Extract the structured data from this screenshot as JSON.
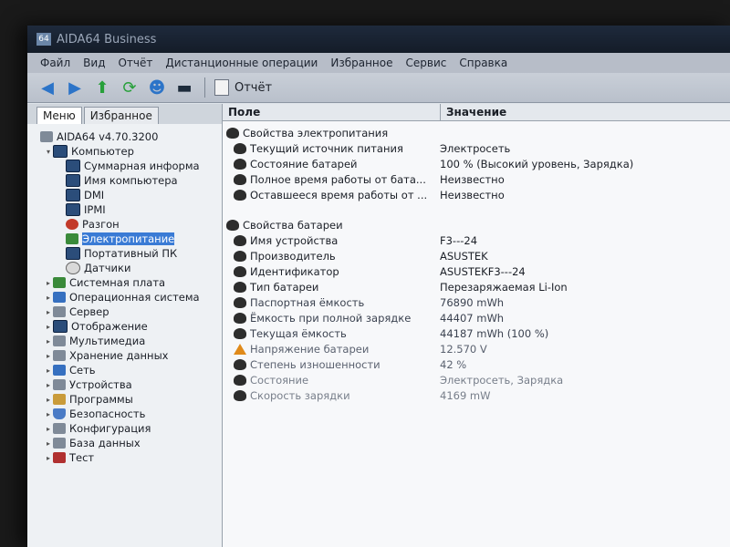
{
  "window": {
    "title": "AIDA64 Business"
  },
  "menu": [
    "Файл",
    "Вид",
    "Отчёт",
    "Дистанционные операции",
    "Избранное",
    "Сервис",
    "Справка"
  ],
  "toolbar": {
    "report_label": "Отчёт"
  },
  "left_tabs": [
    "Меню",
    "Избранное"
  ],
  "tree": [
    {
      "label": "AIDA64 v4.70.3200",
      "level": 0,
      "expander": "",
      "icon": "app"
    },
    {
      "label": "Компьютер",
      "level": 1,
      "expander": "▾",
      "icon": "monitor"
    },
    {
      "label": "Суммарная информа",
      "level": 2,
      "expander": "",
      "icon": "monitor"
    },
    {
      "label": "Имя компьютера",
      "level": 2,
      "expander": "",
      "icon": "monitor"
    },
    {
      "label": "DMI",
      "level": 2,
      "expander": "",
      "icon": "monitor"
    },
    {
      "label": "IPMI",
      "level": 2,
      "expander": "",
      "icon": "monitor"
    },
    {
      "label": "Разгон",
      "level": 2,
      "expander": "",
      "icon": "red"
    },
    {
      "label": "Электропитание",
      "level": 2,
      "expander": "",
      "icon": "chip",
      "selected": true
    },
    {
      "label": "Портативный ПК",
      "level": 2,
      "expander": "",
      "icon": "monitor"
    },
    {
      "label": "Датчики",
      "level": 2,
      "expander": "",
      "icon": "gauge"
    },
    {
      "label": "Системная плата",
      "level": 1,
      "expander": "▸",
      "icon": "chip"
    },
    {
      "label": "Операционная система",
      "level": 1,
      "expander": "▸",
      "icon": "blue"
    },
    {
      "label": "Сервер",
      "level": 1,
      "expander": "▸",
      "icon": "grey"
    },
    {
      "label": "Отображение",
      "level": 1,
      "expander": "▸",
      "icon": "monitor"
    },
    {
      "label": "Мультимедиа",
      "level": 1,
      "expander": "▸",
      "icon": "grey"
    },
    {
      "label": "Хранение данных",
      "level": 1,
      "expander": "▸",
      "icon": "grey"
    },
    {
      "label": "Сеть",
      "level": 1,
      "expander": "▸",
      "icon": "blue"
    },
    {
      "label": "Устройства",
      "level": 1,
      "expander": "▸",
      "icon": "grey"
    },
    {
      "label": "Программы",
      "level": 1,
      "expander": "▸",
      "icon": "folder"
    },
    {
      "label": "Безопасность",
      "level": 1,
      "expander": "▸",
      "icon": "shield"
    },
    {
      "label": "Конфигурация",
      "level": 1,
      "expander": "▸",
      "icon": "grey"
    },
    {
      "label": "База данных",
      "level": 1,
      "expander": "▸",
      "icon": "grey"
    },
    {
      "label": "Тест",
      "level": 1,
      "expander": "▸",
      "icon": "test"
    }
  ],
  "columns": {
    "field": "Поле",
    "value": "Значение"
  },
  "groups": [
    {
      "title": "Свойства электропитания",
      "rows": [
        {
          "field": "Текущий источник питания",
          "value": "Электросеть"
        },
        {
          "field": "Состояние батарей",
          "value": "100 % (Высокий уровень, Зарядка)"
        },
        {
          "field": "Полное время работы от бата...",
          "value": "Неизвестно"
        },
        {
          "field": "Оставшееся время работы от ...",
          "value": "Неизвестно"
        }
      ]
    },
    {
      "title": "Свойства батареи",
      "rows": [
        {
          "field": "Имя устройства",
          "value": "F3---24"
        },
        {
          "field": "Производитель",
          "value": "ASUSTEK"
        },
        {
          "field": "Идентификатор",
          "value": "ASUSTEKF3---24"
        },
        {
          "field": "Тип батареи",
          "value": "Перезаряжаемая Li-Ion"
        },
        {
          "field": "Паспортная ёмкость",
          "value": "76890 mWh"
        },
        {
          "field": "Ёмкость при полной зарядке",
          "value": "44407 mWh"
        },
        {
          "field": "Текущая ёмкость",
          "value": "44187 mWh  (100 %)"
        },
        {
          "field": "Напряжение батареи",
          "value": "12.570 V",
          "warn": true
        },
        {
          "field": "Степень изношенности",
          "value": "42 %"
        },
        {
          "field": "Состояние",
          "value": "Электросеть, Зарядка"
        },
        {
          "field": "Скорость зарядки",
          "value": "4169 mW"
        }
      ]
    }
  ]
}
